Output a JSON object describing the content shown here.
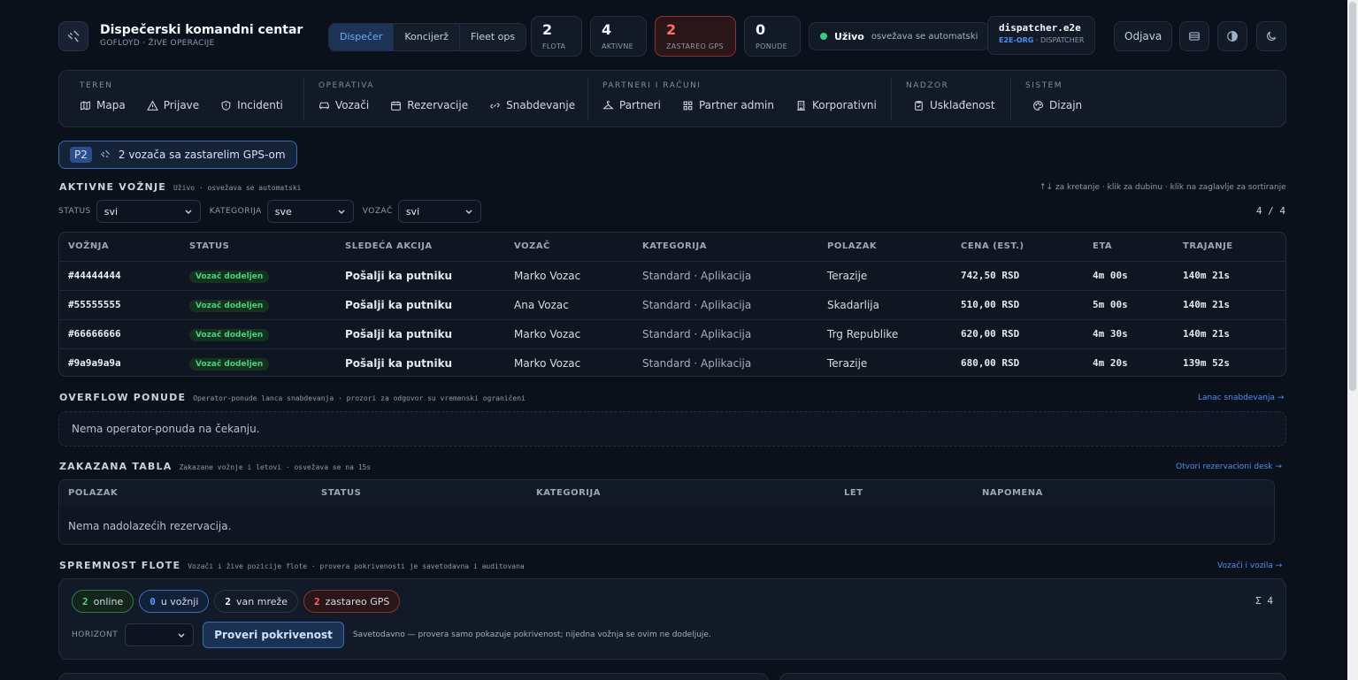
{
  "header": {
    "title": "Dispečerski komandni centar",
    "subtitle": "GOFLOYD · ŽIVE OPERACIJE",
    "views": [
      {
        "label": "Dispečer",
        "active": true
      },
      {
        "label": "Konciјerž",
        "active": false
      },
      {
        "label": "Fleet ops",
        "active": false
      }
    ],
    "stats": [
      {
        "value": "2",
        "label": "FLOTA"
      },
      {
        "value": "4",
        "label": "AKTIVNE"
      },
      {
        "value": "2",
        "label": "ZASTAREO GPS"
      },
      {
        "value": "0",
        "label": "PONUDE"
      }
    ],
    "live_label": "Uživo",
    "live_sub": "osvežava se automatski",
    "user_name": "dispatcher.e2e",
    "user_org": "E2E-ORG",
    "user_role": "· DISPATCHER",
    "logout": "Odjava"
  },
  "nav": {
    "groups": [
      {
        "title": "TEREN",
        "items": [
          "Mapa",
          "Prijave",
          "Incidenti"
        ]
      },
      {
        "title": "OPERATIVA",
        "items": [
          "Vozači",
          "Rezervacije",
          "Snabdevanje"
        ]
      },
      {
        "title": "PARTNERI I RAČUNI",
        "items": [
          "Partneri",
          "Partner admin",
          "Korporativni"
        ]
      },
      {
        "title": "NADZOR",
        "items": [
          "Usklađenost"
        ]
      },
      {
        "title": "SISTEM",
        "items": [
          "Dizajn"
        ]
      }
    ]
  },
  "alert": {
    "badge": "P2",
    "text": "2 vozača sa zastarelim GPS-om"
  },
  "active_rides": {
    "title": "AKTIVNE VOŽNJE",
    "subtitle": "Uživo · osvežava se automatski",
    "hint": "↑↓ za kretanje · klik za dubinu · klik na zaglavlje za sortiranje",
    "filters": [
      {
        "label": "STATUS",
        "value": "svi"
      },
      {
        "label": "KATEGORIJA",
        "value": "sve"
      },
      {
        "label": "VOZAČ",
        "value": "svi"
      }
    ],
    "count": "4 / 4",
    "columns": [
      "VOŽNJA",
      "STATUS",
      "SLEDEĆA AKCIJA",
      "VOZAČ",
      "KATEGORIJA",
      "POLAZAK",
      "CENA (EST.)",
      "ETA",
      "TRAJANJE"
    ],
    "rows": [
      [
        "#44444444",
        "Vozač dodeljen",
        "Pošalji ka putniku",
        "Marko Vozac",
        "Standard · Aplikacija",
        "Terazije",
        "742,50 RSD",
        "4m 00s",
        "140m 21s"
      ],
      [
        "#55555555",
        "Vozač dodeljen",
        "Pošalji ka putniku",
        "Ana Vozac",
        "Standard · Aplikacija",
        "Skadarlija",
        "510,00 RSD",
        "5m 00s",
        "140m 21s"
      ],
      [
        "#66666666",
        "Vozač dodeljen",
        "Pošalji ka putniku",
        "Marko Vozac",
        "Standard · Aplikacija",
        "Trg Republike",
        "620,00 RSD",
        "4m 30s",
        "140m 21s"
      ],
      [
        "#9a9a9a9a",
        "Vozač dodeljen",
        "Pošalji ka putniku",
        "Marko Vozac",
        "Standard · Aplikacija",
        "Terazije",
        "680,00 RSD",
        "4m 20s",
        "139m 52s"
      ]
    ]
  },
  "overflow": {
    "title": "OVERFLOW PONUDE",
    "subtitle": "Operator-ponude lanca snabdevanja · prozori za odgovor su vremenski ograničeni",
    "link": "Lanac snabdevanja →",
    "empty": "Nema operator-ponuda na čekanju."
  },
  "scheduled": {
    "title": "ZAKAZANA TABLA",
    "subtitle": "Zakazane vožnje i letovi · osvežava se na 15s",
    "link": "Otvori rezervacioni desk →",
    "columns": [
      "POLAZAK",
      "STATUS",
      "KATEGORIJA",
      "LET",
      "NAPOMENA"
    ],
    "empty": "Nema nadolazećih rezervacija."
  },
  "fleet": {
    "title": "SPREMNOST FLOTE",
    "subtitle": "Vozači i žive pozicije flote · provera pokrivenosti je savetodavna i auditovana",
    "link": "Vozači i vozila →",
    "chips": [
      {
        "value": "2",
        "label": "online"
      },
      {
        "value": "0",
        "label": "u vožnji"
      },
      {
        "value": "2",
        "label": "van mreže"
      },
      {
        "value": "2",
        "label": "zastareo GPS"
      }
    ],
    "total": "Σ 4",
    "horizon_label": "HORIZONT",
    "horizon_value": "",
    "check_button": "Proveri pokrivenost",
    "advice": "Savetodavno — provera samo pokazuje pokrivenost; nijedna vožnja se ovim ne dodeljuje."
  }
}
